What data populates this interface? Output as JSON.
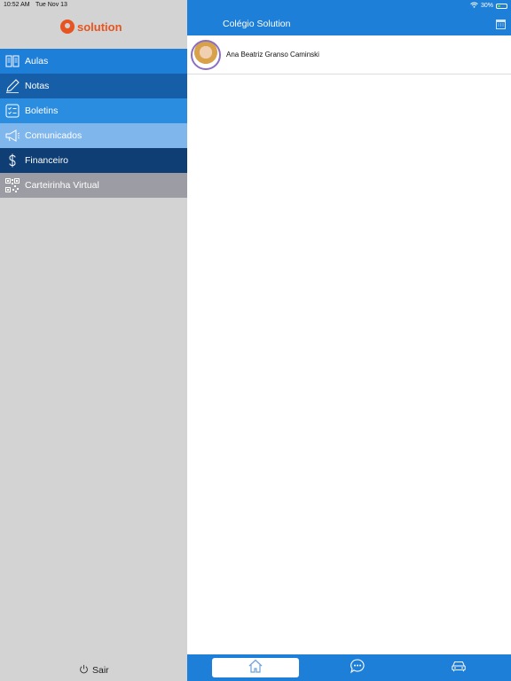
{
  "status": {
    "time": "10:52 AM",
    "date": "Tue Nov 13",
    "battery": "30%"
  },
  "brand": {
    "name": "solution",
    "color": "#e8541f"
  },
  "menu": {
    "items": [
      {
        "label": "Aulas",
        "icon": "book-icon",
        "color": "#1e7fd8"
      },
      {
        "label": "Notas",
        "icon": "pencil-icon",
        "color": "#175ea8"
      },
      {
        "label": "Boletins",
        "icon": "report-card-icon",
        "color": "#2b8de0"
      },
      {
        "label": "Comunicados",
        "icon": "megaphone-icon",
        "color": "#7fb6ec"
      },
      {
        "label": "Financeiro",
        "icon": "dollar-icon",
        "color": "#0f3e74"
      },
      {
        "label": "Carteirinha Virtual",
        "icon": "qr-code-icon",
        "color": "#9c9ca4"
      }
    ]
  },
  "logout": {
    "label": "Sair",
    "icon": "power-icon"
  },
  "header": {
    "title": "Colégio Solution",
    "action_icon": "calendar-icon"
  },
  "students": [
    {
      "name": "Ana Beatriz Granso Caminski"
    }
  ],
  "tabs": [
    {
      "name": "home",
      "icon": "home-icon",
      "active": true
    },
    {
      "name": "messages",
      "icon": "chat-bubble-icon",
      "active": false
    },
    {
      "name": "transport",
      "icon": "car-icon",
      "active": false
    }
  ],
  "colors": {
    "primary": "#1e7fd8",
    "sidebar_bg": "#d3d3d3"
  }
}
